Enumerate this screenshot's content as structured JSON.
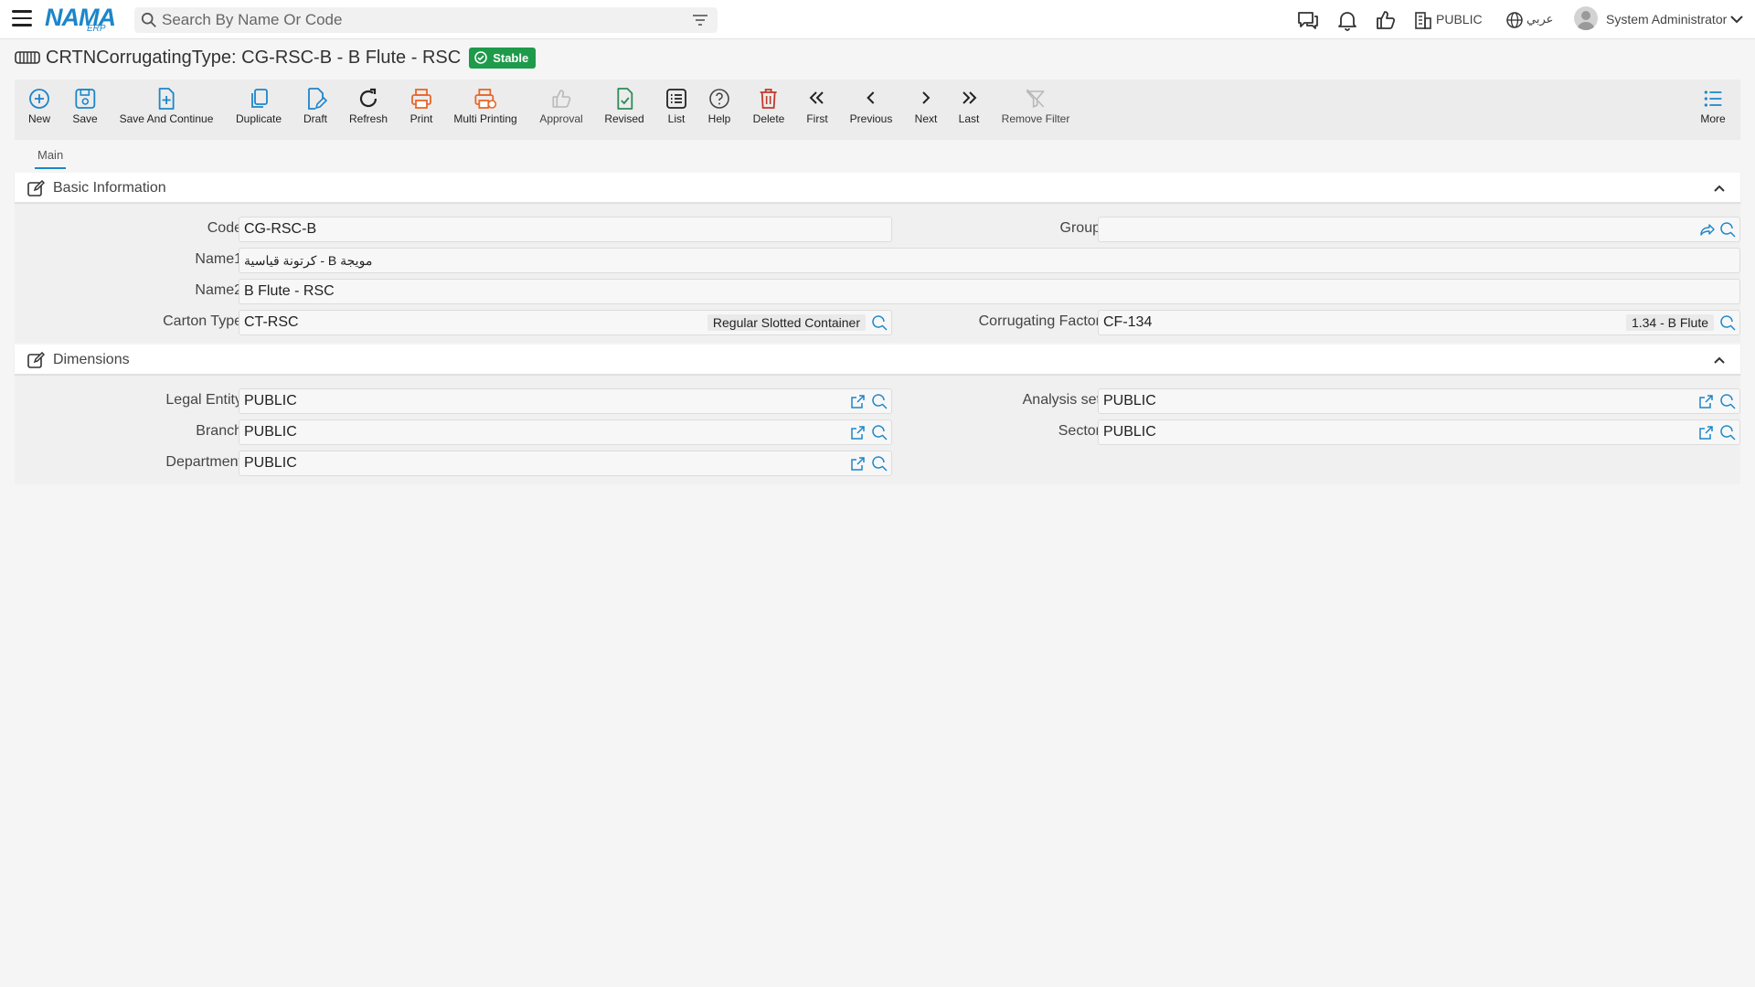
{
  "app": {
    "brand": "NAMA",
    "brand_sub": "ERP",
    "search_placeholder": "Search By Name Or Code",
    "public_label": "PUBLIC",
    "language_label": "عربي",
    "user_name": "System Administrator"
  },
  "page": {
    "title": "CRTNCorrugatingType: CG-RSC-B - B Flute - RSC",
    "status": "Stable"
  },
  "toolbar": {
    "new": "New",
    "save": "Save",
    "save_continue": "Save And Continue",
    "duplicate": "Duplicate",
    "draft": "Draft",
    "refresh": "Refresh",
    "print": "Print",
    "multi_printing": "Multi Printing",
    "approval": "Approval",
    "revised": "Revised",
    "list": "List",
    "help": "Help",
    "delete": "Delete",
    "first": "First",
    "previous": "Previous",
    "next": "Next",
    "last": "Last",
    "remove_filter": "Remove Filter",
    "more": "More"
  },
  "tabs": [
    "Main"
  ],
  "basic": {
    "title": "Basic Information",
    "code_label": "Code",
    "code": "CG-RSC-B",
    "group_label": "Group",
    "group": "",
    "name1_label": "Name1",
    "name1": "كرتونة قياسية - B مويجة",
    "name2_label": "Name2",
    "name2": "B Flute - RSC",
    "carton_type_label": "Carton Type",
    "carton_type": "CT-RSC",
    "carton_type_desc": "Regular Slotted Container",
    "corrugating_factor_label": "Corrugating Factor",
    "corrugating_factor": "CF-134",
    "corrugating_factor_desc": "1.34 - B Flute"
  },
  "dimensions": {
    "title": "Dimensions",
    "legal_entity_label": "Legal Entity",
    "legal_entity": "PUBLIC",
    "analysis_set_label": "Analysis set",
    "analysis_set": "PUBLIC",
    "branch_label": "Branch",
    "branch": "PUBLIC",
    "sector_label": "Sector",
    "sector": "PUBLIC",
    "department_label": "Department",
    "department": "PUBLIC"
  },
  "colors": {
    "accent": "#1c86c9",
    "status_green": "#1e9a4b",
    "print_orange": "#e8672b",
    "delete_red": "#c0392b",
    "revised_green": "#2e8b57"
  }
}
